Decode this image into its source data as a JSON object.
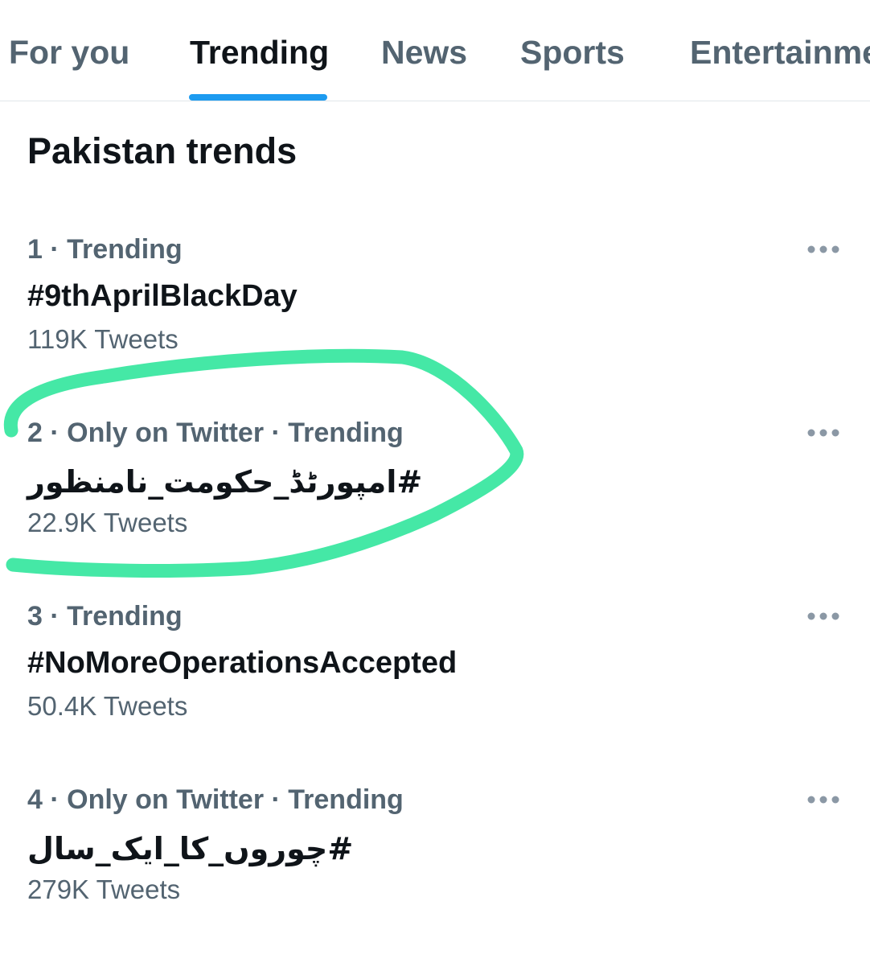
{
  "tabs": {
    "for_you": "For you",
    "trending": "Trending",
    "news": "News",
    "sports": "Sports",
    "entertainment": "Entertainme",
    "active": "Trending"
  },
  "section": {
    "title": "Pakistan trends"
  },
  "trends": [
    {
      "meta": "1 · Trending",
      "name": "#9thAprilBlackDay",
      "count": "119K Tweets"
    },
    {
      "meta": "2 · Only on Twitter · Trending",
      "name": "#امپورٹڈ_حکومت_نامنظور",
      "count": "22.9K Tweets"
    },
    {
      "meta": "3 · Trending",
      "name": "#NoMoreOperationsAccepted",
      "count": "50.4K Tweets"
    },
    {
      "meta": "4 · Only on Twitter · Trending",
      "name": "#چوروں_کا_ایک_سال",
      "count": "279K Tweets"
    }
  ],
  "icons": {
    "more": "more-horizontal-icon"
  },
  "colors": {
    "accent": "#1d9bf0",
    "secondary_text": "#536471",
    "primary_text": "#0f1419",
    "highlight_marker": "#45e8a6"
  }
}
